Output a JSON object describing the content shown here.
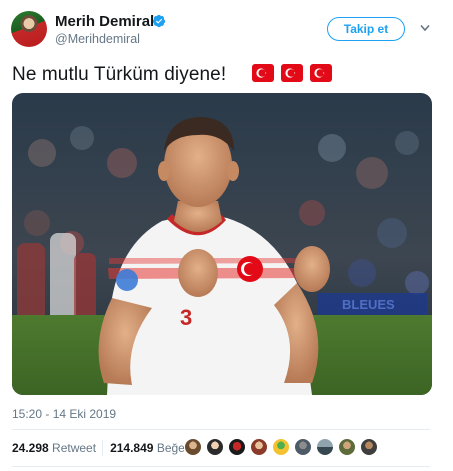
{
  "author": {
    "name": "Merih Demiral",
    "handle": "@Merihdemiral",
    "verified_icon": "verified-badge-icon"
  },
  "follow_button_label": "Takip et",
  "menu_icon": "chevron-down-icon",
  "tweet": {
    "text": "Ne mutlu Türküm diyene!",
    "emojis": [
      "turkish-flag-icon",
      "turkish-flag-icon",
      "turkish-flag-icon"
    ],
    "timestamp": "15:20 - 14 Eki 2019"
  },
  "stats": {
    "retweet_count": "24.298",
    "retweet_label": "Retweet",
    "like_count": "214.849",
    "like_label": "Beğeni"
  },
  "liker_avatars": 8,
  "colors": {
    "accent": "#1da1f2",
    "muted_text": "#657786",
    "text": "#14171a",
    "flag_red": "#e30a17"
  }
}
